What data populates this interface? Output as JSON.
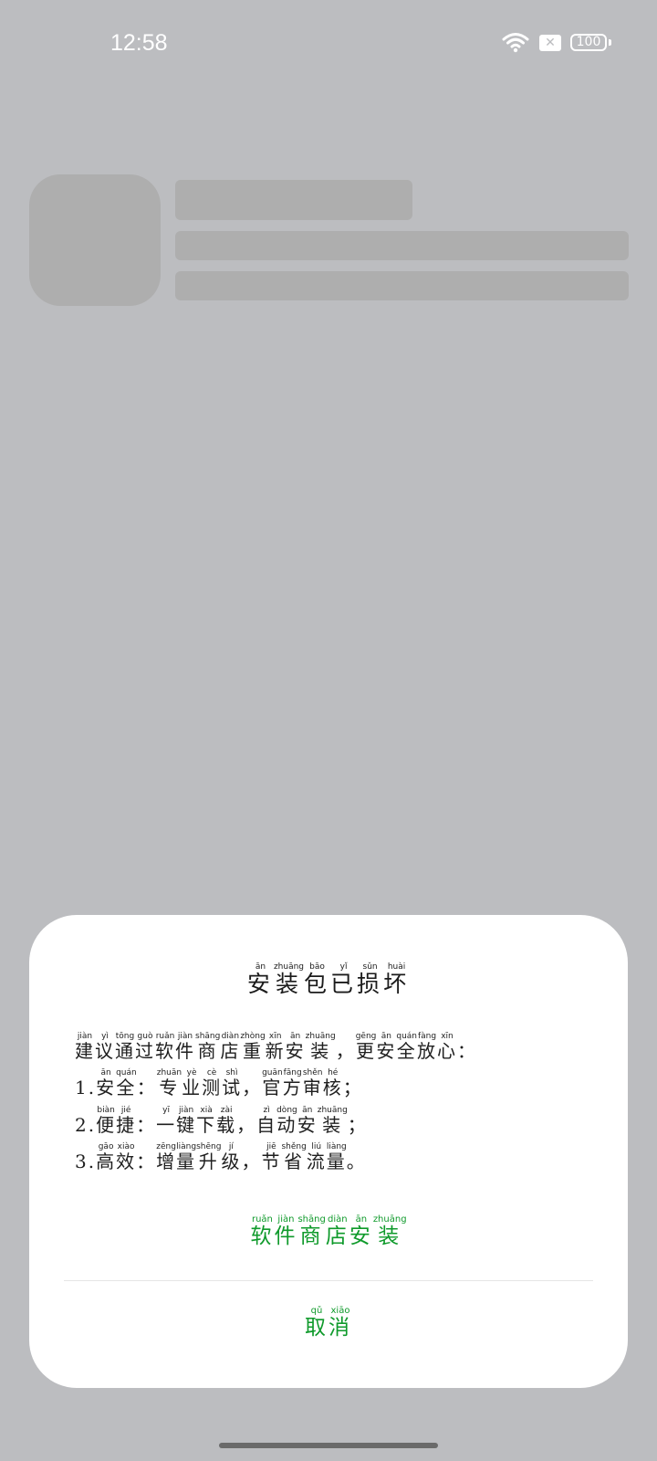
{
  "status_bar": {
    "time": "12:58",
    "sim_icon": "sim-off-icon",
    "battery": "100"
  },
  "dialog": {
    "title": [
      {
        "c": "安",
        "p": "ān"
      },
      {
        "c": "装",
        "p": "zhuāng"
      },
      {
        "c": "包",
        "p": "bāo"
      },
      {
        "c": "已",
        "p": "yǐ"
      },
      {
        "c": "损",
        "p": "sǔn"
      },
      {
        "c": "坏",
        "p": "huài"
      }
    ],
    "body_lines": [
      [
        {
          "c": "建",
          "p": "jiàn"
        },
        {
          "c": "议",
          "p": "yì"
        },
        {
          "c": "通",
          "p": "tōng"
        },
        {
          "c": "过",
          "p": "guò"
        },
        {
          "c": "软",
          "p": "ruǎn"
        },
        {
          "c": "件",
          "p": "jiàn"
        },
        {
          "c": "商",
          "p": "shāng"
        },
        {
          "c": "店",
          "p": "diàn"
        },
        {
          "c": "重",
          "p": "zhòng"
        },
        {
          "c": "新",
          "p": "xīn"
        },
        {
          "c": "安",
          "p": "ān"
        },
        {
          "c": "装",
          "p": "zhuāng"
        },
        {
          "c": "，",
          "p": ""
        },
        {
          "c": "更",
          "p": "gēng"
        },
        {
          "c": "安",
          "p": "ān"
        },
        {
          "c": "全",
          "p": "quán"
        },
        {
          "c": "放",
          "p": "fàng"
        },
        {
          "c": "心",
          "p": "xīn"
        },
        {
          "c": "：",
          "p": ""
        }
      ],
      [
        {
          "c": "1.",
          "p": ""
        },
        {
          "c": "安",
          "p": "ān"
        },
        {
          "c": "全",
          "p": "quán"
        },
        {
          "c": "：",
          "p": ""
        },
        {
          "c": "专",
          "p": "zhuān"
        },
        {
          "c": "业",
          "p": "yè"
        },
        {
          "c": "测",
          "p": "cè"
        },
        {
          "c": "试",
          "p": "shì"
        },
        {
          "c": "，",
          "p": ""
        },
        {
          "c": "官",
          "p": "guān"
        },
        {
          "c": "方",
          "p": "fāng"
        },
        {
          "c": "审",
          "p": "shěn"
        },
        {
          "c": "核",
          "p": "hé"
        },
        {
          "c": "；",
          "p": ""
        }
      ],
      [
        {
          "c": "2.",
          "p": ""
        },
        {
          "c": "便",
          "p": "biàn"
        },
        {
          "c": "捷",
          "p": "jié"
        },
        {
          "c": "：",
          "p": ""
        },
        {
          "c": "一",
          "p": "yī"
        },
        {
          "c": "键",
          "p": "jiàn"
        },
        {
          "c": "下",
          "p": "xià"
        },
        {
          "c": "载",
          "p": "zài"
        },
        {
          "c": "，",
          "p": ""
        },
        {
          "c": "自",
          "p": "zì"
        },
        {
          "c": "动",
          "p": "dòng"
        },
        {
          "c": "安",
          "p": "ān"
        },
        {
          "c": "装",
          "p": "zhuāng"
        },
        {
          "c": "；",
          "p": ""
        }
      ],
      [
        {
          "c": "3.",
          "p": ""
        },
        {
          "c": "高",
          "p": "gāo"
        },
        {
          "c": "效",
          "p": "xiào"
        },
        {
          "c": "：",
          "p": ""
        },
        {
          "c": "增",
          "p": "zēng"
        },
        {
          "c": "量",
          "p": "liàng"
        },
        {
          "c": "升",
          "p": "shēng"
        },
        {
          "c": "级",
          "p": "jí"
        },
        {
          "c": "，",
          "p": ""
        },
        {
          "c": "节",
          "p": "jiē"
        },
        {
          "c": "省",
          "p": "shěng"
        },
        {
          "c": "流",
          "p": "liú"
        },
        {
          "c": "量",
          "p": "liàng"
        },
        {
          "c": "。",
          "p": ""
        }
      ]
    ],
    "store_button": [
      {
        "c": "软",
        "p": "ruǎn"
      },
      {
        "c": "件",
        "p": "jiàn"
      },
      {
        "c": "商",
        "p": "shāng"
      },
      {
        "c": "店",
        "p": "diàn"
      },
      {
        "c": "安",
        "p": "ān"
      },
      {
        "c": "装",
        "p": "zhuāng"
      }
    ],
    "cancel_button": [
      {
        "c": "取",
        "p": "qǔ"
      },
      {
        "c": "消",
        "p": "xiāo"
      }
    ],
    "accent_color": "#0f9a2b"
  }
}
